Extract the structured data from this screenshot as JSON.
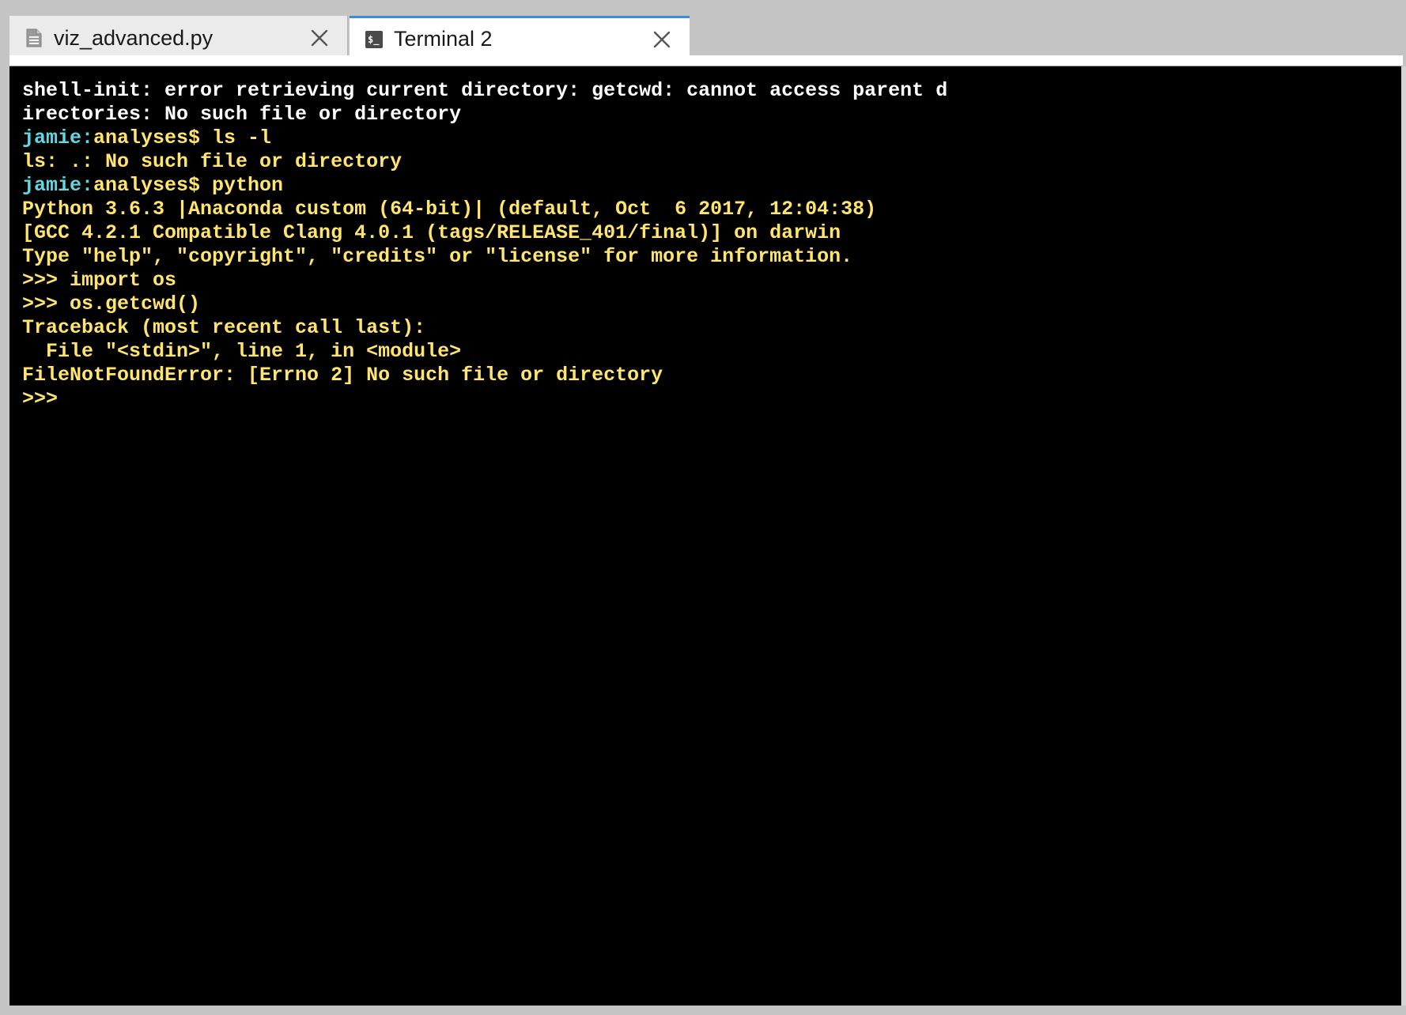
{
  "tabs": [
    {
      "label": "viz_advanced.py",
      "icon": "file-icon",
      "active": false
    },
    {
      "label": "Terminal 2",
      "icon": "terminal-icon",
      "active": true
    }
  ],
  "terminal": {
    "lines": [
      {
        "parts": [
          {
            "text": "shell-init: error retrieving current directory: getcwd: cannot access parent d",
            "color": "white"
          }
        ]
      },
      {
        "parts": [
          {
            "text": "irectories: No such file or directory",
            "color": "white"
          }
        ]
      },
      {
        "parts": [
          {
            "text": "jamie:",
            "color": "cyan"
          },
          {
            "text": "analyses$ ls -l",
            "color": "yellow"
          }
        ]
      },
      {
        "parts": [
          {
            "text": "ls: .: No such file or directory",
            "color": "yellow"
          }
        ]
      },
      {
        "parts": [
          {
            "text": "jamie:",
            "color": "cyan"
          },
          {
            "text": "analyses$ python",
            "color": "yellow"
          }
        ]
      },
      {
        "parts": [
          {
            "text": "Python 3.6.3 |Anaconda custom (64-bit)| (default, Oct  6 2017, 12:04:38)",
            "color": "yellow"
          }
        ]
      },
      {
        "parts": [
          {
            "text": "[GCC 4.2.1 Compatible Clang 4.0.1 (tags/RELEASE_401/final)] on darwin",
            "color": "yellow"
          }
        ]
      },
      {
        "parts": [
          {
            "text": "Type \"help\", \"copyright\", \"credits\" or \"license\" for more information.",
            "color": "yellow"
          }
        ]
      },
      {
        "parts": [
          {
            "text": ">>> import os",
            "color": "yellow"
          }
        ]
      },
      {
        "parts": [
          {
            "text": ">>> os.getcwd()",
            "color": "yellow"
          }
        ]
      },
      {
        "parts": [
          {
            "text": "Traceback (most recent call last):",
            "color": "yellow"
          }
        ]
      },
      {
        "parts": [
          {
            "text": "  File \"<stdin>\", line 1, in <module>",
            "color": "yellow"
          }
        ]
      },
      {
        "parts": [
          {
            "text": "FileNotFoundError: [Errno 2] No such file or directory",
            "color": "yellow"
          }
        ]
      },
      {
        "parts": [
          {
            "text": ">>> ",
            "color": "yellow"
          }
        ]
      }
    ]
  },
  "colors": {
    "terminal_bg": "#000000",
    "text_white": "#ffffff",
    "text_yellow": "#ffe56e",
    "text_cyan": "#5fd7e4",
    "active_tab_accent": "#3c8ae0"
  }
}
